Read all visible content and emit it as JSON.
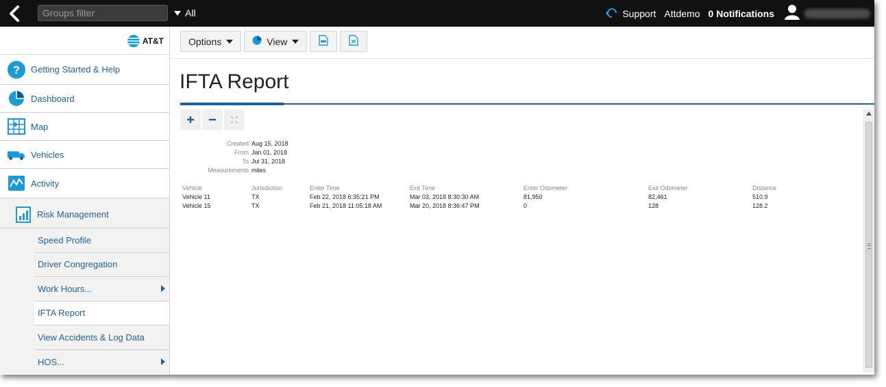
{
  "topbar": {
    "groups_filter_placeholder": "Groups filter",
    "groups_filter_value": "",
    "all_label": "All",
    "support_label": "Support",
    "account_label": "Attdemo",
    "notifications_label": "0 Notifications"
  },
  "sidebar": {
    "logo_text": "AT&T",
    "items": [
      {
        "label": "Getting Started & Help",
        "icon": "help-icon"
      },
      {
        "label": "Dashboard",
        "icon": "pie-chart-icon"
      },
      {
        "label": "Map",
        "icon": "map-icon"
      },
      {
        "label": "Vehicles",
        "icon": "truck-icon"
      },
      {
        "label": "Activity",
        "icon": "activity-icon"
      }
    ],
    "risk_management": {
      "label": "Risk Management",
      "icon": "bar-chart-icon",
      "children": [
        {
          "label": "Speed Profile"
        },
        {
          "label": "Driver Congregation"
        },
        {
          "label": "Work Hours..."
        },
        {
          "label": "IFTA Report"
        },
        {
          "label": "View Accidents & Log Data"
        },
        {
          "label": "HOS..."
        }
      ],
      "active_child": "IFTA Report"
    }
  },
  "toolbar": {
    "options_label": "Options",
    "view_label": "View",
    "export_icons": [
      "pdf-icon",
      "excel-icon"
    ]
  },
  "page": {
    "title": "IFTA Report"
  },
  "report": {
    "meta": [
      {
        "key": "Created",
        "value": "Aug 15, 2018"
      },
      {
        "key": "From",
        "value": "Jan 01, 2018"
      },
      {
        "key": "To",
        "value": "Jul 31, 2018"
      },
      {
        "key": "Measurements",
        "value": "miles"
      }
    ],
    "columns": [
      "Vehicle",
      "Jurisdiction",
      "Enter Time",
      "Exit Time",
      "Enter Odometer",
      "Exit Odometer",
      "Distance"
    ],
    "rows": [
      [
        "Vehicle 11",
        "TX",
        "Feb 22, 2018 6:35:21 PM",
        "Mar 03, 2018 8:30:30 AM",
        "81,950",
        "82,461",
        "510.9"
      ],
      [
        "Vehicle 15",
        "TX",
        "Feb 21, 2018 11:05:18 AM",
        "Mar 20, 2018 8:36:47 PM",
        "0",
        "128",
        "128.2"
      ]
    ]
  },
  "colors": {
    "topbar": "#111111",
    "accent": "#1f5f9e",
    "link": "#1f5f9e"
  }
}
